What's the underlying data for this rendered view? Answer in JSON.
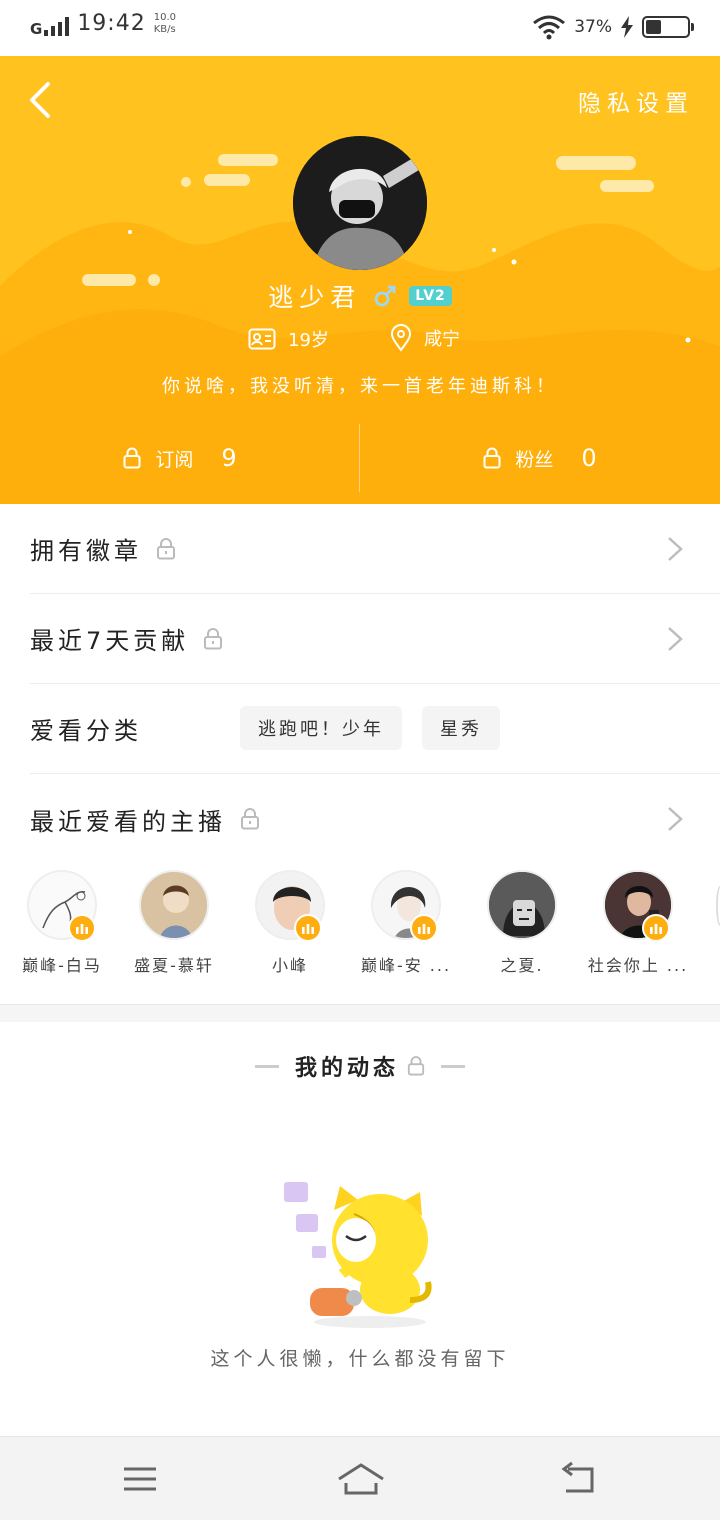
{
  "status_bar": {
    "network": "G",
    "time": "19:42",
    "speed_value": "10.0",
    "speed_unit": "KB/s",
    "battery_percent": "37%",
    "battery_level": 0.37
  },
  "header": {
    "privacy_label": "隐私设置",
    "name": "逃少君",
    "level": "LV2",
    "age": "19岁",
    "city": "咸宁",
    "bio": "你说啥，我没听清，来一首老年迪斯科！",
    "stats": [
      {
        "label": "订阅",
        "value": "9"
      },
      {
        "label": "粉丝",
        "value": "0"
      }
    ],
    "colors": {
      "background": "#FFC21F",
      "level_badge": "#52D0CF"
    }
  },
  "rows": {
    "badges": "拥有徽章",
    "contribution": "最近7天贡献",
    "categories": "爱看分类",
    "anchors": "最近爱看的主播"
  },
  "category_tags": [
    "逃跑吧！少年",
    "星秀"
  ],
  "anchors": [
    {
      "name": "巅峰-白马"
    },
    {
      "name": "盛夏-慕轩"
    },
    {
      "name": "小峰"
    },
    {
      "name": "巅峰-安 ..."
    },
    {
      "name": "之夏."
    },
    {
      "name": "社会你上 ..."
    }
  ],
  "dynamics": {
    "title": "我的动态",
    "empty_text": "这个人很懒，什么都没有留下"
  }
}
